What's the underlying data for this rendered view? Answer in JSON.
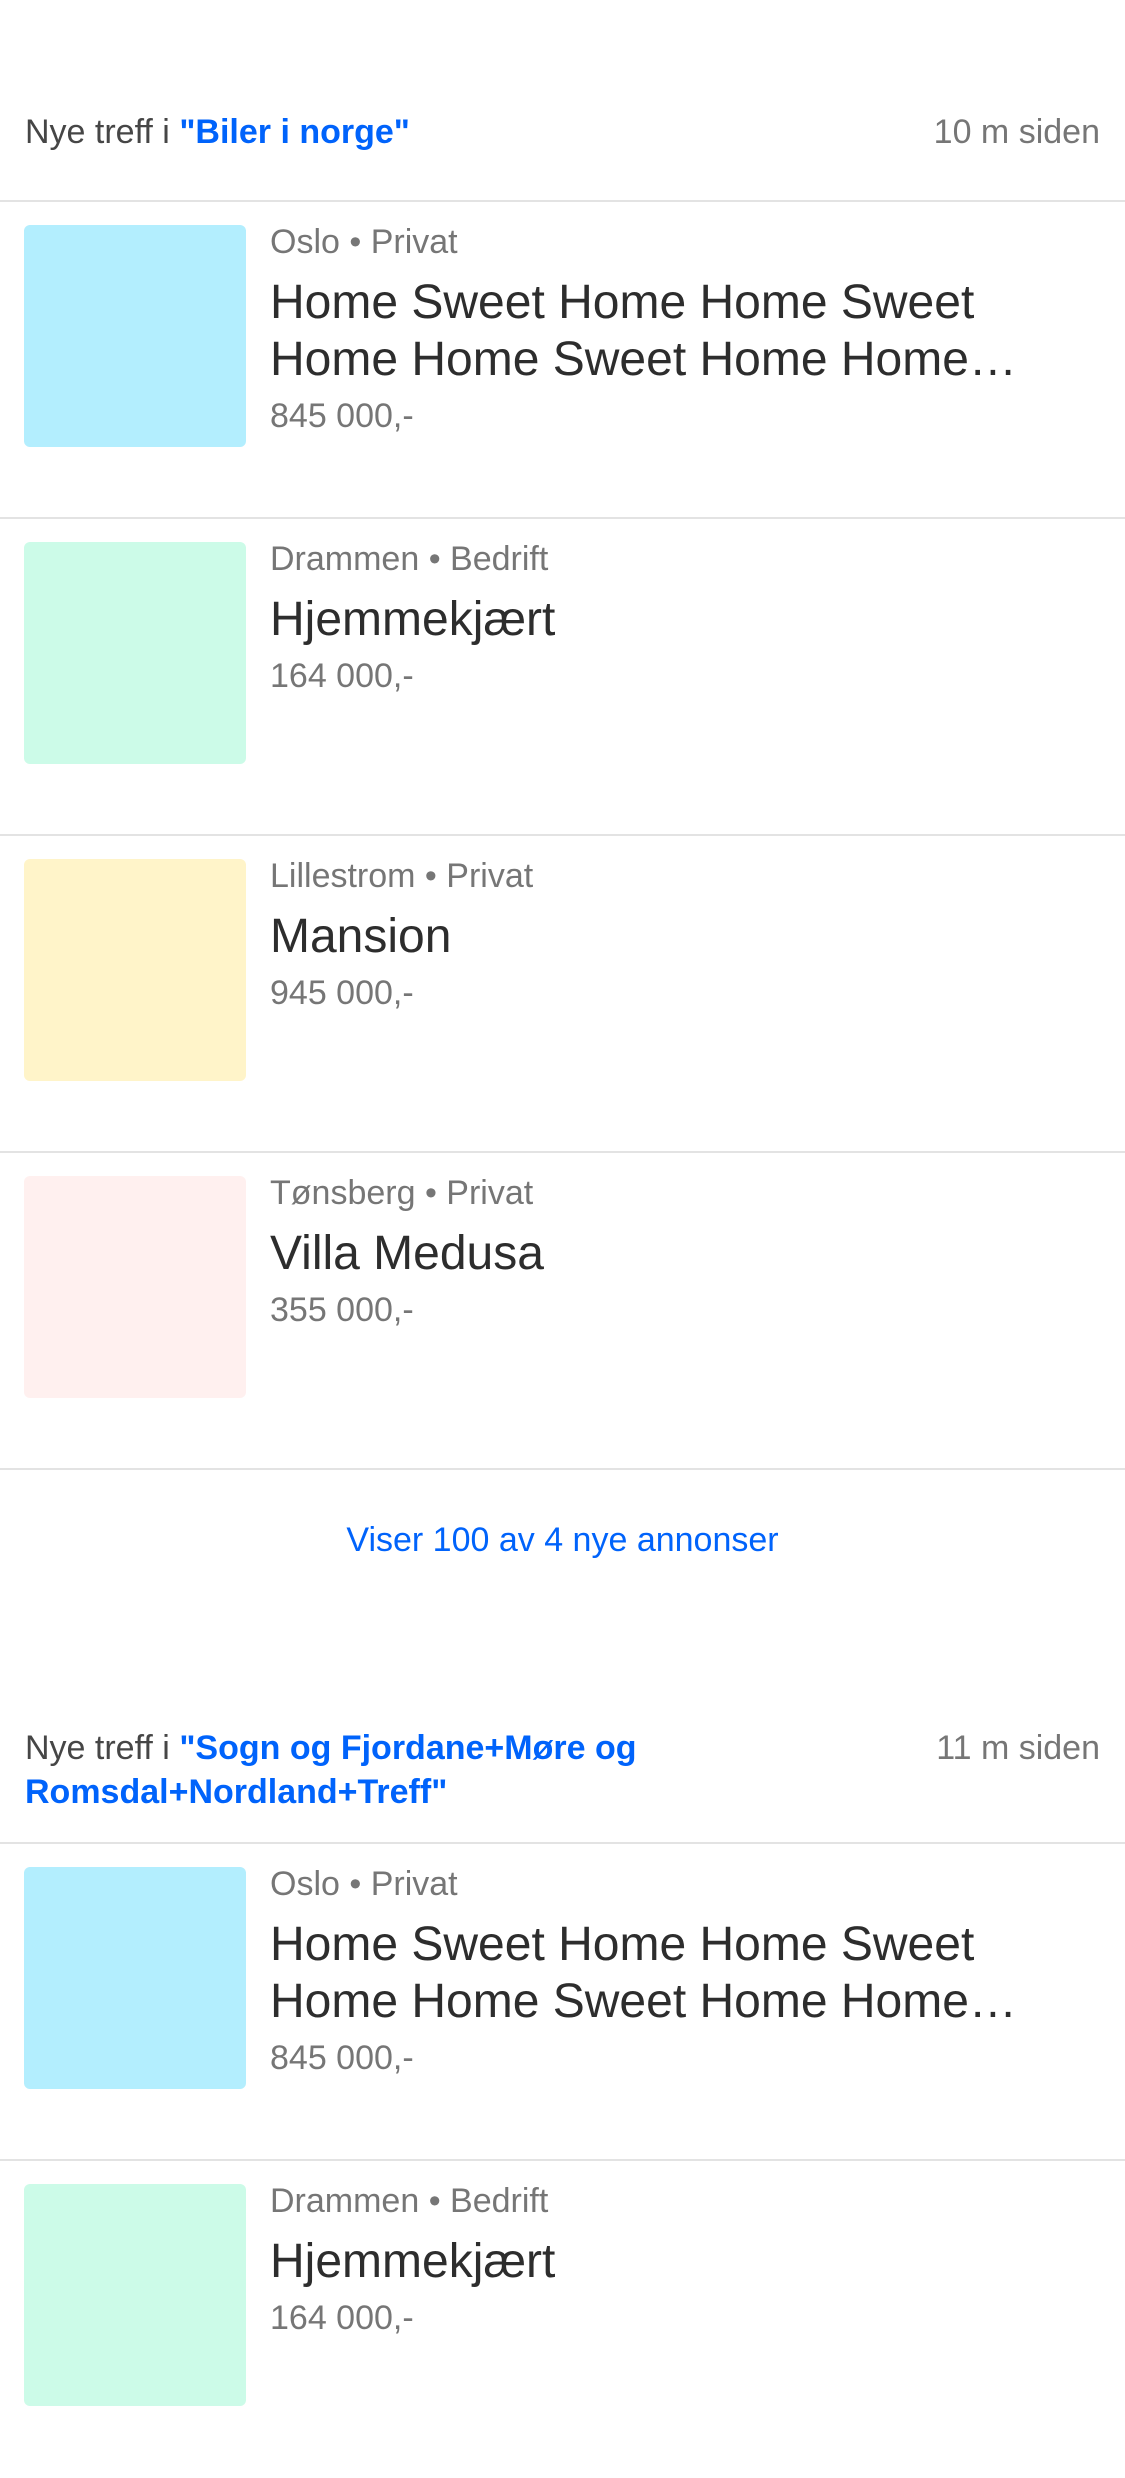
{
  "sections": [
    {
      "header_prefix": "Nye treff i ",
      "query": "\"Biler i norge\"",
      "time": "10 m siden",
      "ads": [
        {
          "meta": "Oslo • Privat",
          "title": "Home Sweet Home Home Sweet Home Home Sweet Home Home Sweet Home Home Sweet Home",
          "price": "845 000,-",
          "thumb_color": "#b3eefe"
        },
        {
          "meta": "Drammen • Bedrift",
          "title": "Hjemmekjært",
          "price": "164 000,-",
          "thumb_color": "#ccfbe8"
        },
        {
          "meta": "Lillestrom • Privat",
          "title": "Mansion",
          "price": "945 000,-",
          "thumb_color": "#fff4c9"
        },
        {
          "meta": "Tønsberg • Privat",
          "title": "Villa Medusa",
          "price": "355 000,-",
          "thumb_color": "#fff0ef"
        }
      ],
      "more_link": "Viser 100 av 4 nye annonser"
    },
    {
      "header_prefix": "Nye treff i ",
      "query": "\"Sogn og Fjordane+Møre og Romsdal+Nordland+Treff\"",
      "time": "11 m siden",
      "ads": [
        {
          "meta": "Oslo • Privat",
          "title": "Home Sweet Home Home Sweet Home Home Sweet Home Home Sweet Home Home Sweet Home",
          "price": "845 000,-",
          "thumb_color": "#b3eefe"
        },
        {
          "meta": "Drammen • Bedrift",
          "title": "Hjemmekjært",
          "price": "164 000,-",
          "thumb_color": "#ccfbe8"
        }
      ]
    }
  ]
}
